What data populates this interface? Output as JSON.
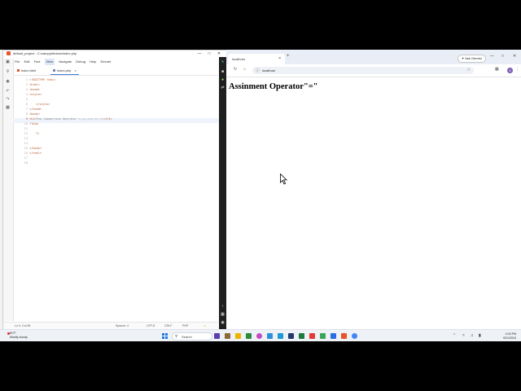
{
  "editor": {
    "title": "default_project - C:\\xampp\\htdocs\\index.php",
    "menu": [
      "File",
      "Edit",
      "Find",
      "View",
      "Navigate",
      "Debug",
      "Help",
      "Emmet"
    ],
    "tabs": [
      {
        "label": "index.html",
        "active": false
      },
      {
        "label": "index.php",
        "active": true
      }
    ],
    "line_numbers": [
      "1",
      "2",
      "3",
      "4",
      "5",
      "6",
      "7",
      "8",
      "9",
      "10",
      "11",
      "12",
      "13",
      "14",
      "15",
      "16",
      "17",
      "18"
    ],
    "code": {
      "l1": "<!DOCTYPE html>",
      "l2": "<html>",
      "l3": "<head>",
      "l4": "<style>",
      "l6": "</style>",
      "l7": "</head>",
      "l8": "<body>",
      "l9_tag_open": "<h1>",
      "l9_text": "Php Comparison Operator =,==,===,<>,!=",
      "l9_tag_close": "</h1>",
      "l10": "<?php",
      "l12": "?>",
      "l15": "</body>",
      "l16": "</html>"
    },
    "status": {
      "position": "Ln 9, Col 55",
      "spaces": "Spaces: 4",
      "encoding": "UTF-8",
      "line_ending": "CRLF",
      "language": "PHP"
    }
  },
  "browser": {
    "tab_title": "localhost",
    "url": "localhost",
    "gemini_label": "Ask Gemini",
    "avatar_letter": "G",
    "heading": "Assinment Operator\"=\""
  },
  "taskbar": {
    "weather_temp": "81°F",
    "weather_desc": "Mostly cloudy",
    "search_placeholder": "Search",
    "time": "4:43 PM",
    "date": "9/21/2024"
  },
  "colors": {
    "accent": "#3d7be0",
    "code_tag": "#b35a2a",
    "windows_blue": "#1f7ae0"
  }
}
